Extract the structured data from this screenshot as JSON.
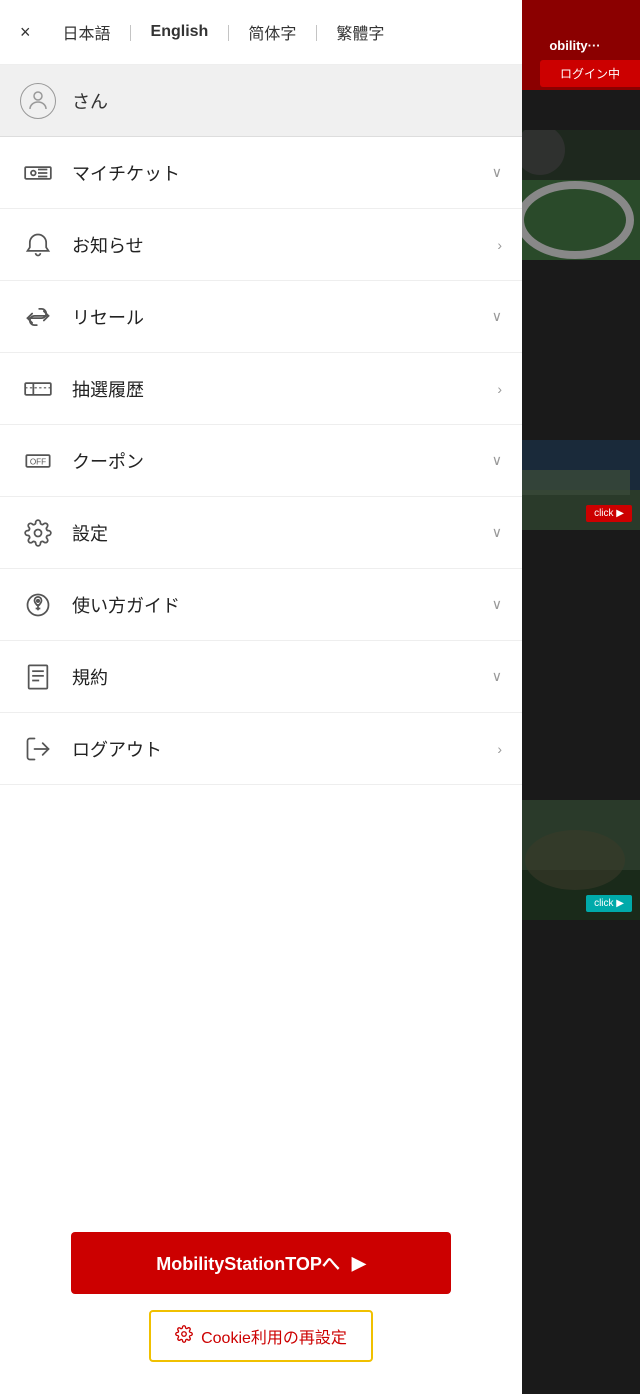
{
  "lang_bar": {
    "close_label": "×",
    "languages": [
      {
        "label": "日本語",
        "active": false
      },
      {
        "label": "English",
        "active": false
      },
      {
        "label": "简体字",
        "active": false
      },
      {
        "label": "繁體字",
        "active": false
      }
    ]
  },
  "user": {
    "name": "さん"
  },
  "menu_items": [
    {
      "id": "my-ticket",
      "label": "マイチケット",
      "arrow": "chevron-down"
    },
    {
      "id": "notifications",
      "label": "お知らせ",
      "arrow": "chevron-right"
    },
    {
      "id": "resale",
      "label": "リセール",
      "arrow": "chevron-down"
    },
    {
      "id": "lottery-history",
      "label": "抽選履歴",
      "arrow": "chevron-right"
    },
    {
      "id": "coupon",
      "label": "クーポン",
      "arrow": "chevron-down"
    },
    {
      "id": "settings",
      "label": "設定",
      "arrow": "chevron-down"
    },
    {
      "id": "how-to",
      "label": "使い方ガイド",
      "arrow": "chevron-down"
    },
    {
      "id": "terms",
      "label": "規約",
      "arrow": "chevron-down"
    },
    {
      "id": "logout",
      "label": "ログアウト",
      "arrow": "chevron-right"
    }
  ],
  "mobility_btn": {
    "label": "MobilityStationTOPへ",
    "arrow": "▶"
  },
  "cookie_btn": {
    "label": "Cookie利用の再設定"
  },
  "right_panel": {
    "title": "obility···",
    "login_text": "ログイン中",
    "click_label": "click ▶"
  }
}
